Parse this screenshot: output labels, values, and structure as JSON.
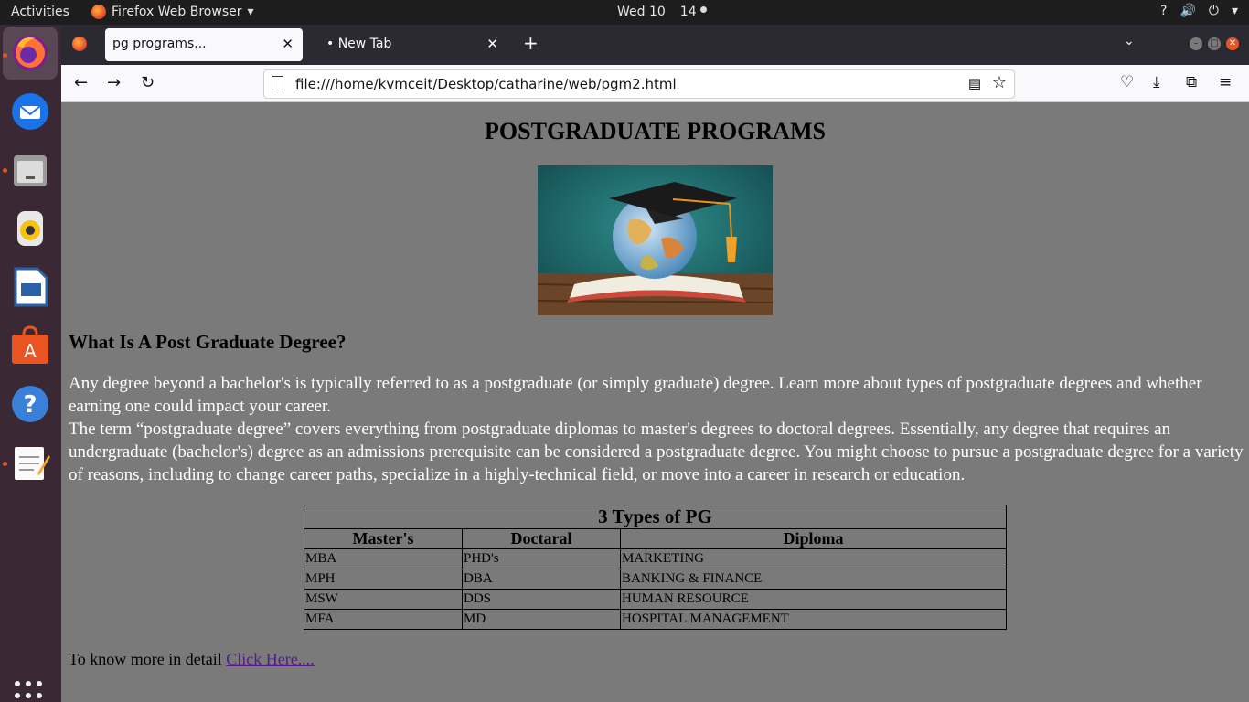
{
  "system_bar": {
    "activities": "Activities",
    "app_name": "Firefox Web Browser",
    "date": "Wed 10",
    "time": "14"
  },
  "browser": {
    "tabs": [
      {
        "label": "pg programs..."
      },
      {
        "label": "• New Tab"
      }
    ],
    "url": "file:///home/kvmceit/Desktop/catharine/web/pgm2.html"
  },
  "page": {
    "title": "POSTGRADUATE PROGRAMS",
    "subtitle": "What Is A Post Graduate Degree?",
    "paragraph1": "Any degree beyond a bachelor's is typically referred to as a postgraduate (or simply graduate) degree. Learn more about types of postgraduate degrees and whether earning one could impact your career.",
    "paragraph2": "The term “postgraduate degree” covers everything from postgraduate diplomas to master's degrees to doctoral degrees. Essentially, any degree that requires an undergraduate (bachelor's) degree as an admissions prerequisite can be considered a postgraduate degree. You might choose to pursue a postgraduate degree for a variety of reasons, including to change career paths, specialize in a highly-technical field, or move into a career in research or education.",
    "table": {
      "caption": "3 Types of PG",
      "headers": [
        "Master's",
        "Doctaral",
        "Diploma"
      ],
      "rows": [
        [
          "MBA",
          "PHD's",
          "MARKETING"
        ],
        [
          "MPH",
          "DBA",
          "BANKING & FINANCE"
        ],
        [
          "MSW",
          "DDS",
          "HUMAN RESOURCE"
        ],
        [
          "MFA",
          "MD",
          "HOSPITAL MANAGEMENT"
        ]
      ]
    },
    "more_text": "To know more in detail ",
    "more_link": "Click Here...."
  },
  "colors": {
    "page_bg": "#7a7a7a",
    "dock_bg": "#3b2835",
    "link": "#551a8b"
  }
}
